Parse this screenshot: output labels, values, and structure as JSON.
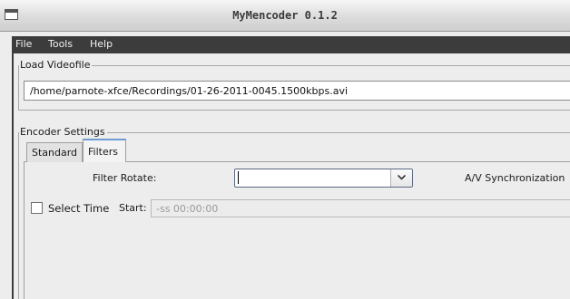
{
  "window": {
    "title": "MyMencoder 0.1.2",
    "icon": "window-icon"
  },
  "menubar": {
    "items": [
      "File",
      "Tools",
      "Help"
    ]
  },
  "load_group": {
    "legend": "Load Videofile",
    "path_value": "/home/parnote-xfce/Recordings/01-26-2011-0045.1500kbps.avi"
  },
  "encoder_group": {
    "legend": "Encoder Settings"
  },
  "tabs": [
    {
      "label": "Standard",
      "selected": false
    },
    {
      "label": "Filters",
      "selected": true
    }
  ],
  "filters": {
    "rotate_label": "Filter Rotate:",
    "rotate_value": "",
    "av_sync_label": "A/V Synchronization"
  },
  "time": {
    "select_label": "Select Time",
    "select_checked": false,
    "start_label": "Start:",
    "start_placeholder": "-ss 00:00:00"
  },
  "colors": {
    "menubar": "#3c3c3c",
    "tab_accent": "#6e9bd1",
    "combo_border": "#5a6a80"
  }
}
